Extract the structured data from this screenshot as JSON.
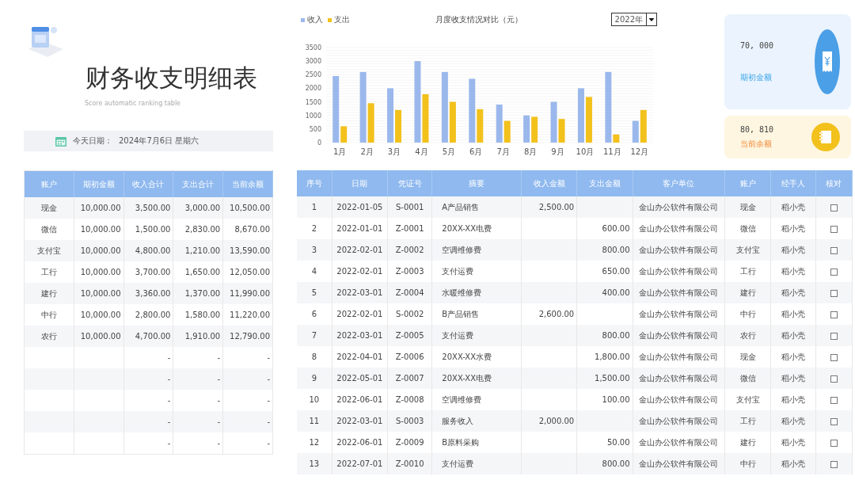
{
  "header": {
    "title": "财务收支明细表",
    "subtitle": "Score automatic ranking table",
    "date_label": "今天日期：",
    "date_value": "2024年7月6日 星期六"
  },
  "chart": {
    "year_select": "2022年",
    "chart_data": {
      "type": "bar",
      "title": "月度收支情况对比（元）",
      "categories": [
        "1月",
        "2月",
        "3月",
        "4月",
        "5月",
        "6月",
        "7月",
        "8月",
        "9月",
        "10月",
        "11月",
        "12月"
      ],
      "series": [
        {
          "name": "收入",
          "color": "#9bb8ec",
          "values": [
            2450,
            2600,
            2000,
            3000,
            2600,
            2350,
            1400,
            1000,
            1500,
            2000,
            2600,
            800
          ]
        },
        {
          "name": "支出",
          "color": "#f2c11c",
          "values": [
            600,
            1450,
            1200,
            1780,
            1500,
            1230,
            800,
            950,
            870,
            1680,
            300,
            1200
          ]
        }
      ],
      "grid": true,
      "legend": true,
      "ylim": [
        0,
        3500
      ],
      "yticks": [
        0,
        500,
        1000,
        1500,
        2000,
        2500,
        3000,
        3500
      ]
    }
  },
  "cards": [
    {
      "kind": "opening",
      "value": "70, 000",
      "label": "期初金额"
    },
    {
      "kind": "current",
      "value": "80, 810",
      "label": "当前余额"
    }
  ],
  "summary_table": {
    "columns": [
      "账户",
      "期初金额",
      "收入合计",
      "支出合计",
      "当前余额"
    ],
    "rows": [
      {
        "account": "现金",
        "opening": "10,000.00",
        "income": "3,500.00",
        "expense": "3,000.00",
        "balance": "10,500.00"
      },
      {
        "account": "微信",
        "opening": "10,000.00",
        "income": "1,500.00",
        "expense": "2,830.00",
        "balance": "8,670.00"
      },
      {
        "account": "支付宝",
        "opening": "10,000.00",
        "income": "4,800.00",
        "expense": "1,210.00",
        "balance": "13,590.00"
      },
      {
        "account": "工行",
        "opening": "10,000.00",
        "income": "3,700.00",
        "expense": "1,650.00",
        "balance": "12,050.00"
      },
      {
        "account": "建行",
        "opening": "10,000.00",
        "income": "3,360.00",
        "expense": "1,370.00",
        "balance": "11,990.00"
      },
      {
        "account": "中行",
        "opening": "10,000.00",
        "income": "2,800.00",
        "expense": "1,580.00",
        "balance": "11,220.00"
      },
      {
        "account": "农行",
        "opening": "10,000.00",
        "income": "4,700.00",
        "expense": "1,910.00",
        "balance": "12,790.00"
      },
      {
        "income": "-",
        "expense": "-",
        "balance": "-"
      },
      {
        "income": "-",
        "expense": "-",
        "balance": "-"
      },
      {
        "income": "-",
        "expense": "-",
        "balance": "-"
      },
      {
        "income": "-",
        "expense": "-",
        "balance": "-"
      },
      {
        "income": "-",
        "expense": "-",
        "balance": "-"
      }
    ]
  },
  "detail_table": {
    "columns": [
      "序号",
      "日期",
      "凭证号",
      "摘要",
      "收入金额",
      "支出金额",
      "客户单位",
      "账户",
      "经手人",
      "核对"
    ],
    "rows": [
      {
        "no": "1",
        "date": "2022-01-05",
        "voucher": "S-0001",
        "summary": "A产品销售",
        "income": "2,500.00",
        "client": "金山办公软件有限公司",
        "account": "现金",
        "handler": "稻小壳",
        "checked": false
      },
      {
        "no": "2",
        "date": "2022-01-01",
        "voucher": "Z-0001",
        "summary": "20XX-XX电费",
        "expense": "600.00",
        "client": "金山办公软件有限公司",
        "account": "微信",
        "handler": "稻小壳",
        "checked": false
      },
      {
        "no": "3",
        "date": "2022-02-01",
        "voucher": "Z-0002",
        "summary": "空调维修费",
        "expense": "800.00",
        "client": "金山办公软件有限公司",
        "account": "支付宝",
        "handler": "稻小壳",
        "checked": false
      },
      {
        "no": "4",
        "date": "2022-02-01",
        "voucher": "Z-0003",
        "summary": "支付运费",
        "expense": "650.00",
        "client": "金山办公软件有限公司",
        "account": "工行",
        "handler": "稻小壳",
        "checked": false
      },
      {
        "no": "5",
        "date": "2022-03-01",
        "voucher": "Z-0004",
        "summary": "水暖维修费",
        "expense": "400.00",
        "client": "金山办公软件有限公司",
        "account": "建行",
        "handler": "稻小壳",
        "checked": false
      },
      {
        "no": "6",
        "date": "2022-02-01",
        "voucher": "S-0002",
        "summary": "B产品销售",
        "income": "2,600.00",
        "client": "金山办公软件有限公司",
        "account": "中行",
        "handler": "稻小壳",
        "checked": false
      },
      {
        "no": "7",
        "date": "2022-03-01",
        "voucher": "Z-0005",
        "summary": "支付运费",
        "expense": "800.00",
        "client": "金山办公软件有限公司",
        "account": "农行",
        "handler": "稻小壳",
        "checked": false
      },
      {
        "no": "8",
        "date": "2022-04-01",
        "voucher": "Z-0006",
        "summary": "20XX-XX水费",
        "expense": "1,800.00",
        "client": "金山办公软件有限公司",
        "account": "现金",
        "handler": "稻小壳",
        "checked": false
      },
      {
        "no": "9",
        "date": "2022-05-01",
        "voucher": "Z-0007",
        "summary": "20XX-XX电费",
        "expense": "1,500.00",
        "client": "金山办公软件有限公司",
        "account": "微信",
        "handler": "稻小壳",
        "checked": false
      },
      {
        "no": "10",
        "date": "2022-06-01",
        "voucher": "Z-0008",
        "summary": "空调维修费",
        "expense": "100.00",
        "client": "金山办公软件有限公司",
        "account": "支付宝",
        "handler": "稻小壳",
        "checked": false
      },
      {
        "no": "11",
        "date": "2022-03-01",
        "voucher": "S-0003",
        "summary": "服务收入",
        "income": "2,000.00",
        "client": "金山办公软件有限公司",
        "account": "工行",
        "handler": "稻小壳",
        "checked": false
      },
      {
        "no": "12",
        "date": "2022-06-01",
        "voucher": "Z-0009",
        "summary": "B原料采购",
        "expense": "50.00",
        "client": "金山办公软件有限公司",
        "account": "建行",
        "handler": "稻小壳",
        "checked": false
      },
      {
        "no": "13",
        "date": "2022-07-01",
        "voucher": "Z-0010",
        "summary": "支付运费",
        "expense": "800.00",
        "client": "金山办公软件有限公司",
        "account": "中行",
        "handler": "稻小壳",
        "checked": false
      }
    ]
  }
}
